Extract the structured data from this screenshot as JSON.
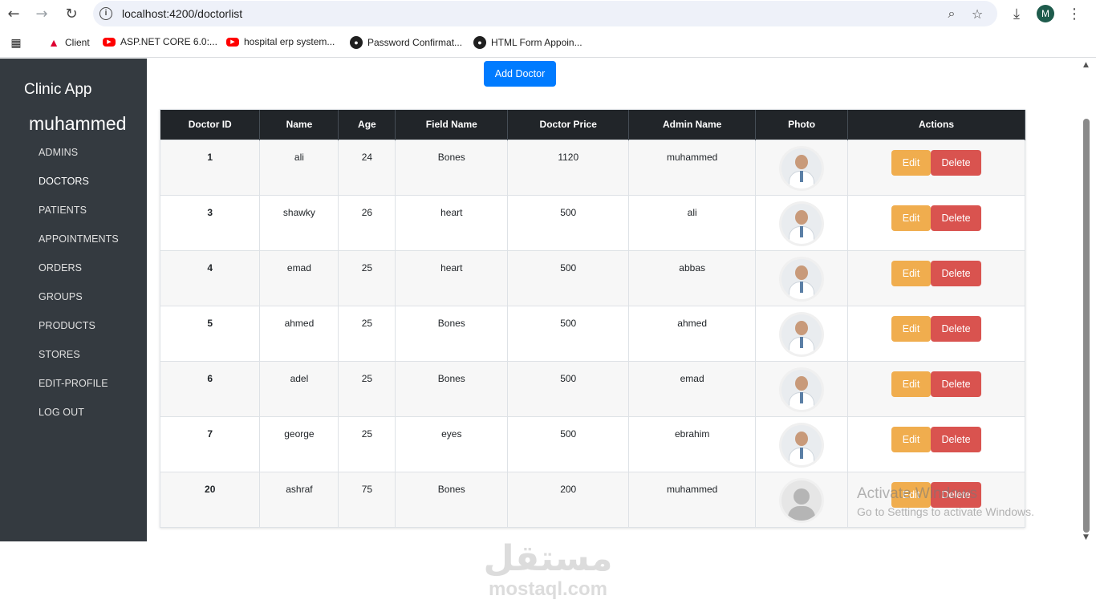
{
  "browser": {
    "url": "localhost:4200/doctorlist",
    "profile_initial": "M",
    "bookmarks": [
      {
        "label": "Client",
        "icon": "angular-icon"
      },
      {
        "label": "ASP.NET CORE 6.0:...",
        "icon": "youtube-icon"
      },
      {
        "label": "hospital erp system...",
        "icon": "youtube-icon"
      },
      {
        "label": "Password Confirmat...",
        "icon": "github-icon"
      },
      {
        "label": "HTML Form Appoin...",
        "icon": "github-icon"
      }
    ]
  },
  "sidebar": {
    "brand": "Clinic App",
    "user": "muhammed",
    "items": [
      {
        "label": "ADMINS"
      },
      {
        "label": "DOCTORS",
        "active": true
      },
      {
        "label": "PATIENTS"
      },
      {
        "label": "APPOINTMENTS"
      },
      {
        "label": "ORDERS"
      },
      {
        "label": "GROUPS"
      },
      {
        "label": "PRODUCTS"
      },
      {
        "label": "STORES"
      },
      {
        "label": "EDIT-PROFILE"
      },
      {
        "label": "LOG OUT"
      }
    ]
  },
  "main": {
    "add_button": "Add Doctor",
    "columns": [
      "Doctor ID",
      "Name",
      "Age",
      "Field Name",
      "Doctor Price",
      "Admin Name",
      "Photo",
      "Actions"
    ],
    "edit_label": "Edit",
    "delete_label": "Delete",
    "rows": [
      {
        "id": "1",
        "name": "ali",
        "age": "24",
        "field": "Bones",
        "price": "1120",
        "admin": "muhammed",
        "photo": "doctor-photo"
      },
      {
        "id": "3",
        "name": "shawky",
        "age": "26",
        "field": "heart",
        "price": "500",
        "admin": "ali",
        "photo": "doctor-photo"
      },
      {
        "id": "4",
        "name": "emad",
        "age": "25",
        "field": "heart",
        "price": "500",
        "admin": "abbas",
        "photo": "doctor-photo"
      },
      {
        "id": "5",
        "name": "ahmed",
        "age": "25",
        "field": "Bones",
        "price": "500",
        "admin": "ahmed",
        "photo": "doctor-photo"
      },
      {
        "id": "6",
        "name": "adel",
        "age": "25",
        "field": "Bones",
        "price": "500",
        "admin": "emad",
        "photo": "doctor-photo"
      },
      {
        "id": "7",
        "name": "george",
        "age": "25",
        "field": "eyes",
        "price": "500",
        "admin": "ebrahim",
        "photo": "doctor-photo"
      },
      {
        "id": "20",
        "name": "ashraf",
        "age": "75",
        "field": "Bones",
        "price": "200",
        "admin": "muhammed",
        "photo": "placeholder-avatar"
      }
    ]
  },
  "overlay": {
    "activate_title": "Activate Windows",
    "activate_sub": "Go to Settings to activate Windows.",
    "watermark_ar": "مستقل",
    "watermark_en": "mostaql.com"
  },
  "colors": {
    "sidebar_bg": "#343a40",
    "table_header_bg": "#212529",
    "primary": "#007bff",
    "edit": "#f0ad4e",
    "delete": "#d9534f"
  }
}
